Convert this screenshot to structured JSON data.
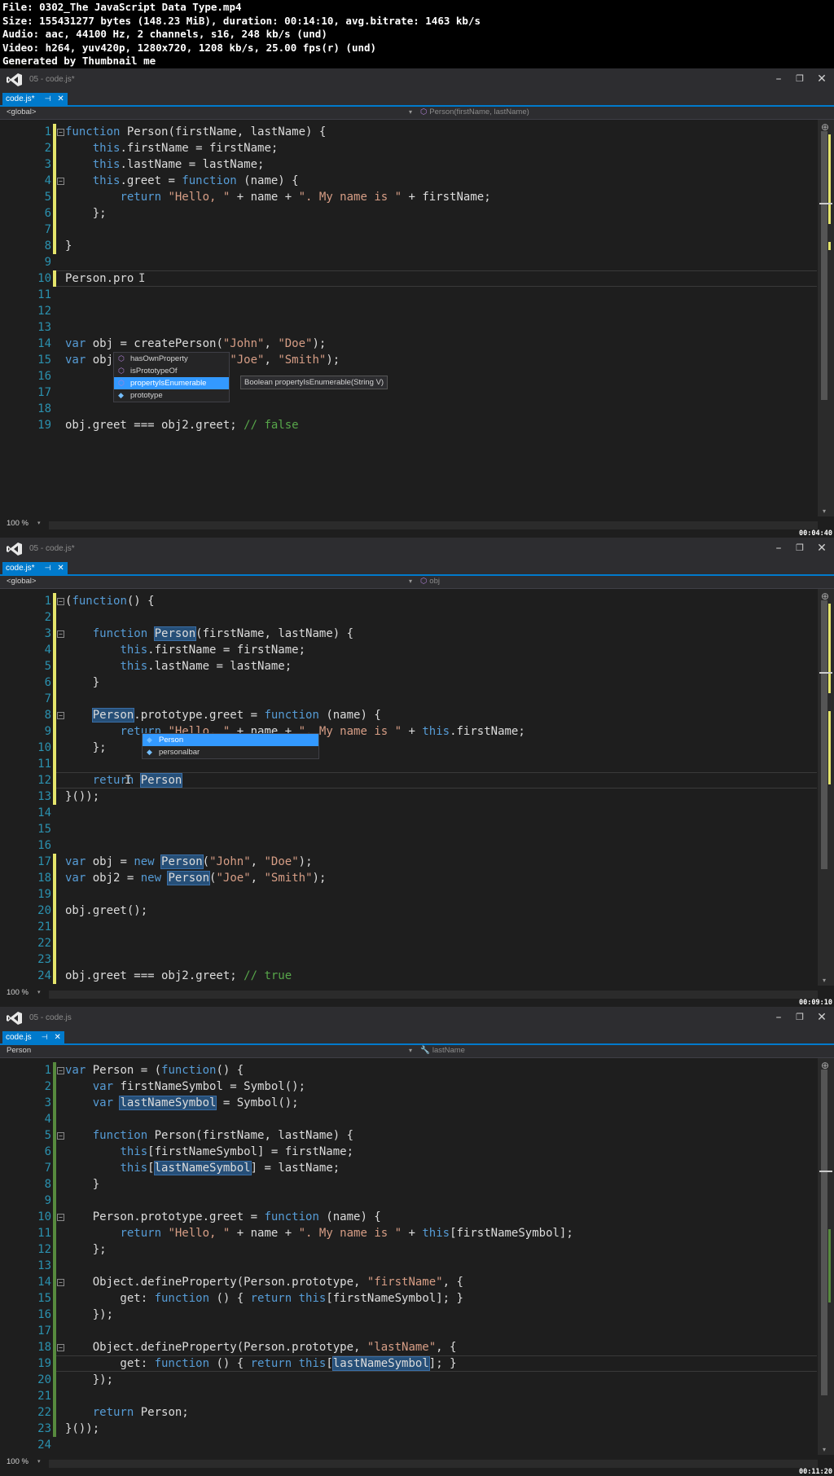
{
  "meta": {
    "file": "File: 0302_The JavaScript Data Type.mp4",
    "size": "Size: 155431277 bytes (148.23 MiB), duration: 00:14:10, avg.bitrate: 1463 kb/s",
    "audio": "Audio: aac, 44100 Hz, 2 channels, s16, 248 kb/s (und)",
    "video": "Video: h264, yuv420p, 1280x720, 1208 kb/s, 25.00 fps(r) (und)",
    "generated": "Generated by Thumbnail me"
  },
  "icons": {
    "logo": "visual-studio-logo",
    "minimize": "–",
    "maximize": "❐",
    "close": "✕",
    "pin": "⊣",
    "tab_close": "✕",
    "dropdown": "▾",
    "scroll_up": "⊕",
    "scroll_down": "▾",
    "zoom_arrow": "▾",
    "method": "⬡",
    "field": "◆",
    "wrench": "🔧"
  },
  "colors": {
    "keyword": "#569cd6",
    "string": "#d69d85",
    "comment": "#57a64a",
    "line_number": "#2b91af",
    "accent": "#007acc",
    "unsaved_change": "#e5e56b",
    "saved_change": "#578a3e",
    "completion_selected": "#3399ff"
  },
  "panels": [
    {
      "window_title": "05 - code.js*",
      "tab_label": "code.js*",
      "scope": "<global>",
      "member": "Person(firstName, lastName)",
      "zoom": "100 %",
      "timestamp": "00:04:40",
      "lines": [
        {
          "n": "1",
          "code": "function Person(firstName, lastName) {"
        },
        {
          "n": "2",
          "code": "    this.firstName = firstName;"
        },
        {
          "n": "3",
          "code": "    this.lastName = lastName;"
        },
        {
          "n": "4",
          "code": "    this.greet = function (name) {"
        },
        {
          "n": "5",
          "code": "        return \"Hello, \" + name + \". My name is \" + firstName;"
        },
        {
          "n": "6",
          "code": "    };"
        },
        {
          "n": "7",
          "code": ""
        },
        {
          "n": "8",
          "code": "}"
        },
        {
          "n": "9",
          "code": ""
        },
        {
          "n": "10",
          "code": "Person.pro"
        },
        {
          "n": "11",
          "code": ""
        },
        {
          "n": "12",
          "code": ""
        },
        {
          "n": "13",
          "code": ""
        },
        {
          "n": "14",
          "code": "var obj = createPerson(\"John\", \"Doe\");"
        },
        {
          "n": "15",
          "code": "var obj2 = createPerson(\"Joe\", \"Smith\");"
        },
        {
          "n": "16",
          "code": ""
        },
        {
          "n": "17",
          "code": ""
        },
        {
          "n": "18",
          "code": ""
        },
        {
          "n": "19",
          "code": "obj.greet === obj2.greet; // false"
        }
      ],
      "completion": {
        "items": [
          "hasOwnProperty",
          "isPrototypeOf",
          "propertyIsEnumerable",
          "prototype"
        ],
        "selected": "propertyIsEnumerable",
        "tooltip": "Boolean propertyIsEnumerable(String V)"
      }
    },
    {
      "window_title": "05 - code.js*",
      "tab_label": "code.js*",
      "scope": "<global>",
      "member": "obj",
      "zoom": "100 %",
      "timestamp": "00:09:10",
      "lines": [
        {
          "n": "1",
          "code": "(function() {"
        },
        {
          "n": "2",
          "code": ""
        },
        {
          "n": "3",
          "code": "    function Person(firstName, lastName) {"
        },
        {
          "n": "4",
          "code": "        this.firstName = firstName;"
        },
        {
          "n": "5",
          "code": "        this.lastName = lastName;"
        },
        {
          "n": "6",
          "code": "    }"
        },
        {
          "n": "7",
          "code": ""
        },
        {
          "n": "8",
          "code": "    Person.prototype.greet = function (name) {"
        },
        {
          "n": "9",
          "code": "        return \"Hello, \" + name + \". My name is \" + this.firstName;"
        },
        {
          "n": "10",
          "code": "    };"
        },
        {
          "n": "11",
          "code": ""
        },
        {
          "n": "12",
          "code": "    return Person"
        },
        {
          "n": "13",
          "code": "}());"
        },
        {
          "n": "14",
          "code": ""
        },
        {
          "n": "15",
          "code": ""
        },
        {
          "n": "16",
          "code": ""
        },
        {
          "n": "17",
          "code": "var obj = new Person(\"John\", \"Doe\");"
        },
        {
          "n": "18",
          "code": "var obj2 = new Person(\"Joe\", \"Smith\");"
        },
        {
          "n": "19",
          "code": ""
        },
        {
          "n": "20",
          "code": "obj.greet();"
        },
        {
          "n": "21",
          "code": ""
        },
        {
          "n": "22",
          "code": ""
        },
        {
          "n": "23",
          "code": ""
        },
        {
          "n": "24",
          "code": "obj.greet === obj2.greet; // true"
        }
      ],
      "completion": {
        "items": [
          "Person",
          "personalbar"
        ],
        "selected": "Person"
      }
    },
    {
      "window_title": "05 - code.js",
      "tab_label": "code.js",
      "scope": "Person",
      "member": "lastName",
      "zoom": "100 %",
      "timestamp": "00:11:20",
      "lines": [
        {
          "n": "1",
          "code": "var Person = (function() {"
        },
        {
          "n": "2",
          "code": "    var firstNameSymbol = Symbol();"
        },
        {
          "n": "3",
          "code": "    var lastNameSymbol = Symbol();"
        },
        {
          "n": "4",
          "code": ""
        },
        {
          "n": "5",
          "code": "    function Person(firstName, lastName) {"
        },
        {
          "n": "6",
          "code": "        this[firstNameSymbol] = firstName;"
        },
        {
          "n": "7",
          "code": "        this[lastNameSymbol] = lastName;"
        },
        {
          "n": "8",
          "code": "    }"
        },
        {
          "n": "9",
          "code": ""
        },
        {
          "n": "10",
          "code": "    Person.prototype.greet = function (name) {"
        },
        {
          "n": "11",
          "code": "        return \"Hello, \" + name + \". My name is \" + this[firstNameSymbol];"
        },
        {
          "n": "12",
          "code": "    };"
        },
        {
          "n": "13",
          "code": ""
        },
        {
          "n": "14",
          "code": "    Object.defineProperty(Person.prototype, \"firstName\", {"
        },
        {
          "n": "15",
          "code": "        get: function () { return this[firstNameSymbol]; }"
        },
        {
          "n": "16",
          "code": "    });"
        },
        {
          "n": "17",
          "code": ""
        },
        {
          "n": "18",
          "code": "    Object.defineProperty(Person.prototype, \"lastName\", {"
        },
        {
          "n": "19",
          "code": "        get: function () { return this[lastNameSymbol]; }"
        },
        {
          "n": "20",
          "code": "    });"
        },
        {
          "n": "21",
          "code": ""
        },
        {
          "n": "22",
          "code": "    return Person;"
        },
        {
          "n": "23",
          "code": "}());"
        },
        {
          "n": "24",
          "code": ""
        },
        {
          "n": "25",
          "code": ""
        }
      ]
    }
  ]
}
